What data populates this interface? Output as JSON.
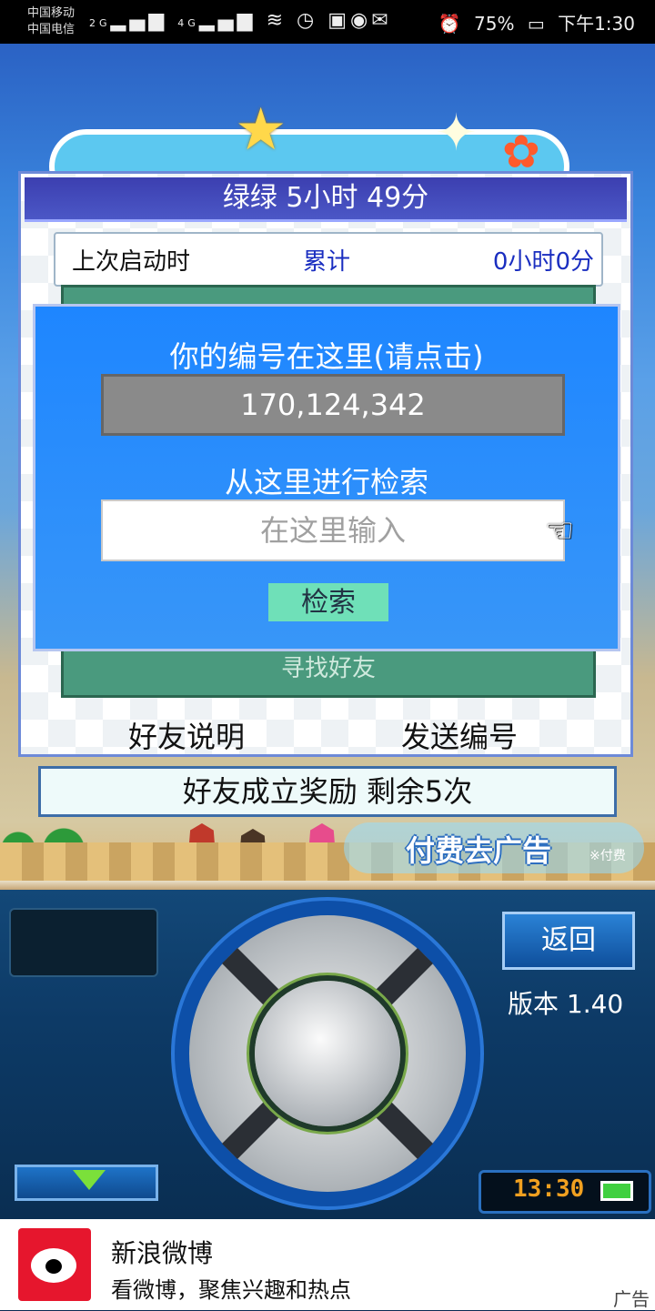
{
  "status_bar": {
    "carrier_1": "中国移动",
    "carrier_2": "中国电信",
    "net_1": "2G",
    "net_2": "4G",
    "battery": "75%",
    "time": "下午1:30"
  },
  "dialog": {
    "title": "绿绿  5小时 49分",
    "last_launch_label": "上次启动时",
    "total_label": "累计",
    "total_value": "0小时0分",
    "hidden_text": "寻找好友",
    "friend_help": "好友说明",
    "send_id": "发送编号"
  },
  "search_dialog": {
    "title": "你的编号在这里(请点击)",
    "player_id": "170,124,342",
    "search_prompt": "从这里进行检索",
    "input_placeholder": "在这里输入",
    "input_value": "",
    "search_button": "检索"
  },
  "reward_bar": "好友成立奖励  剩余5次",
  "ad_removal": {
    "label": "付费去广告",
    "note": "※付费"
  },
  "console": {
    "back_button": "返回",
    "version": "版本 1.40",
    "clock": "13:30"
  },
  "ad_banner": {
    "title": "新浪微博",
    "subtitle": "看微博，聚焦兴趣和热点",
    "label": "广告"
  },
  "colors": {
    "dialog_title_bg": "#3c3fb0",
    "overlay_bg": "#1e86ff",
    "panel_green": "#4a9a7e",
    "search_button": "#6fe0b8",
    "accent_blue_text": "#1a2ec0"
  },
  "icons": [
    "signal-icon",
    "wifi-icon",
    "alarm-icon",
    "battery-icon",
    "star-icon",
    "flower-icon",
    "pointer-hand-icon",
    "down-arrow-icon",
    "weibo-logo-icon"
  ]
}
